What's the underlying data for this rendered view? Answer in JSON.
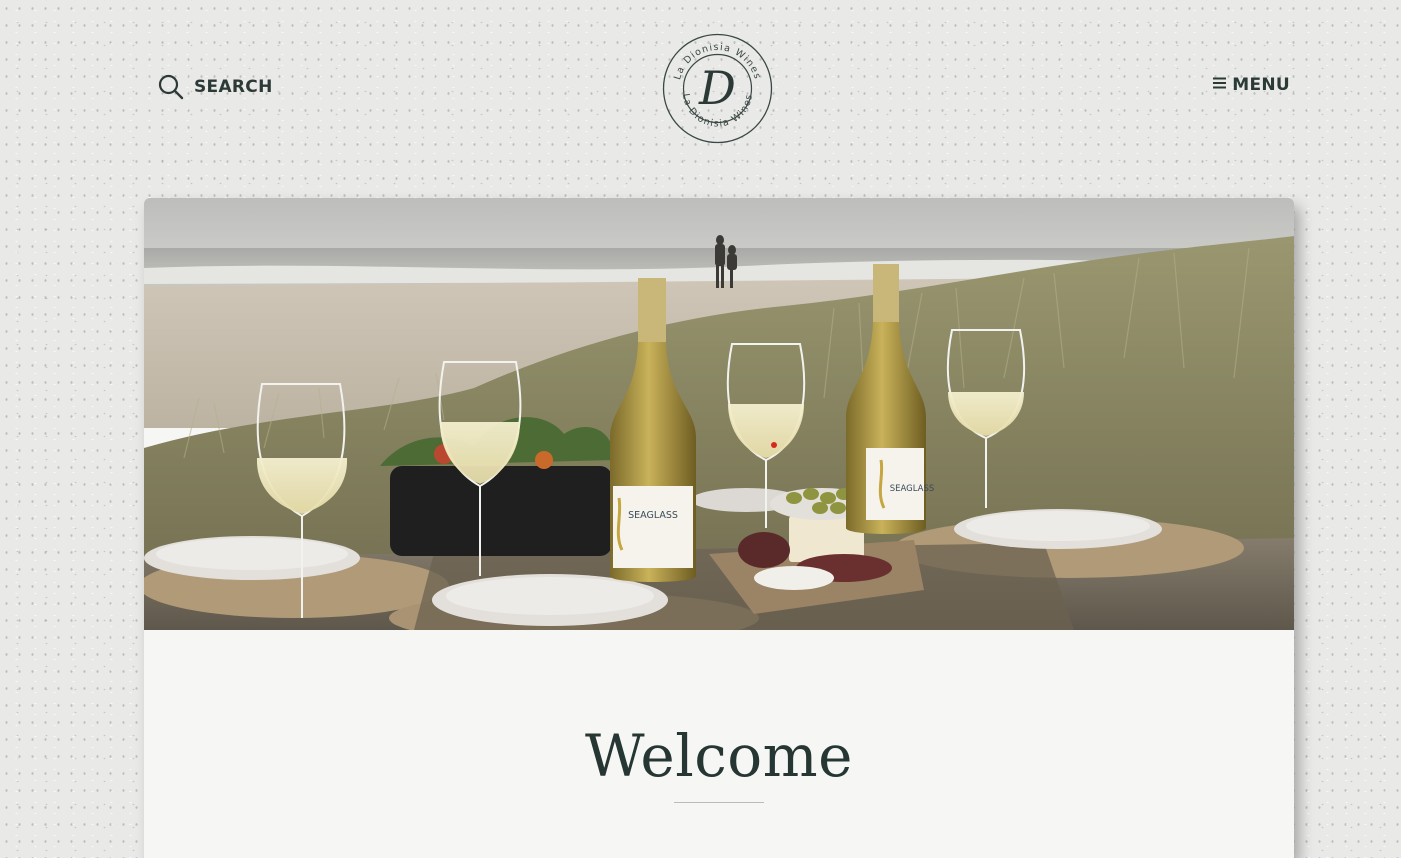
{
  "header": {
    "search_label": "SEARCH",
    "menu_label": "MENU",
    "logo": {
      "monogram": "D",
      "ring_text_top": "La Dionisia Wines",
      "ring_text_bottom": "La Dionisia Wines"
    }
  },
  "hero": {
    "bottle_label_left": "SEAGLASS",
    "bottle_label_right": "SEAGLASS"
  },
  "main": {
    "heading": "Welcome"
  },
  "colors": {
    "ink": "#2c3a37",
    "background": "#e9e9e8",
    "card": "#f6f6f5"
  },
  "icons": {
    "search": "search-icon",
    "menu": "hamburger-icon"
  }
}
